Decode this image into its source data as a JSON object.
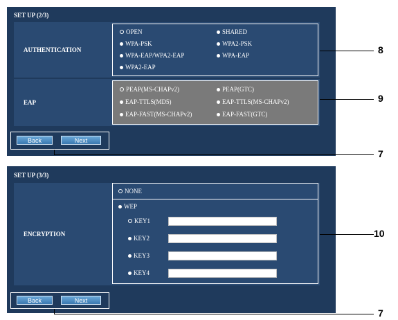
{
  "setup2": {
    "title": "SET UP (2/3)",
    "auth_label": "AUTHENTICATION",
    "auth_options": [
      "OPEN",
      "SHARED",
      "WPA-PSK",
      "WPA2-PSK",
      "WPA-EAP/WPA2-EAP",
      "WPA-EAP",
      "WPA2-EAP"
    ],
    "auth_selected": "OPEN",
    "eap_label": "EAP",
    "eap_options": [
      "PEAP(MS-CHAPv2)",
      "PEAP(GTC)",
      "EAP-TTLS(MD5)",
      "EAP-TTLS(MS-CHAPv2)",
      "EAP-FAST(MS-CHAPv2)",
      "EAP-FAST(GTC)"
    ],
    "eap_selected": "PEAP(MS-CHAPv2)",
    "back_label": "Back",
    "next_label": "Next"
  },
  "setup3": {
    "title": "SET UP (3/3)",
    "enc_label": "ENCRYPTION",
    "none_label": "NONE",
    "wep_label": "WEP",
    "keys": [
      "KEY1",
      "KEY2",
      "KEY3",
      "KEY4"
    ],
    "key_values": [
      "",
      "",
      "",
      ""
    ],
    "back_label": "Back",
    "next_label": "Next"
  },
  "callouts": {
    "auth": "8",
    "eap": "9",
    "buttons1": "7",
    "encryption": "10",
    "buttons2": "7"
  },
  "colors": {
    "panel": "#1f3a5c",
    "row": "#2a4a72",
    "eap_box": "#7a7a7a",
    "button": "#4a8cc4"
  }
}
